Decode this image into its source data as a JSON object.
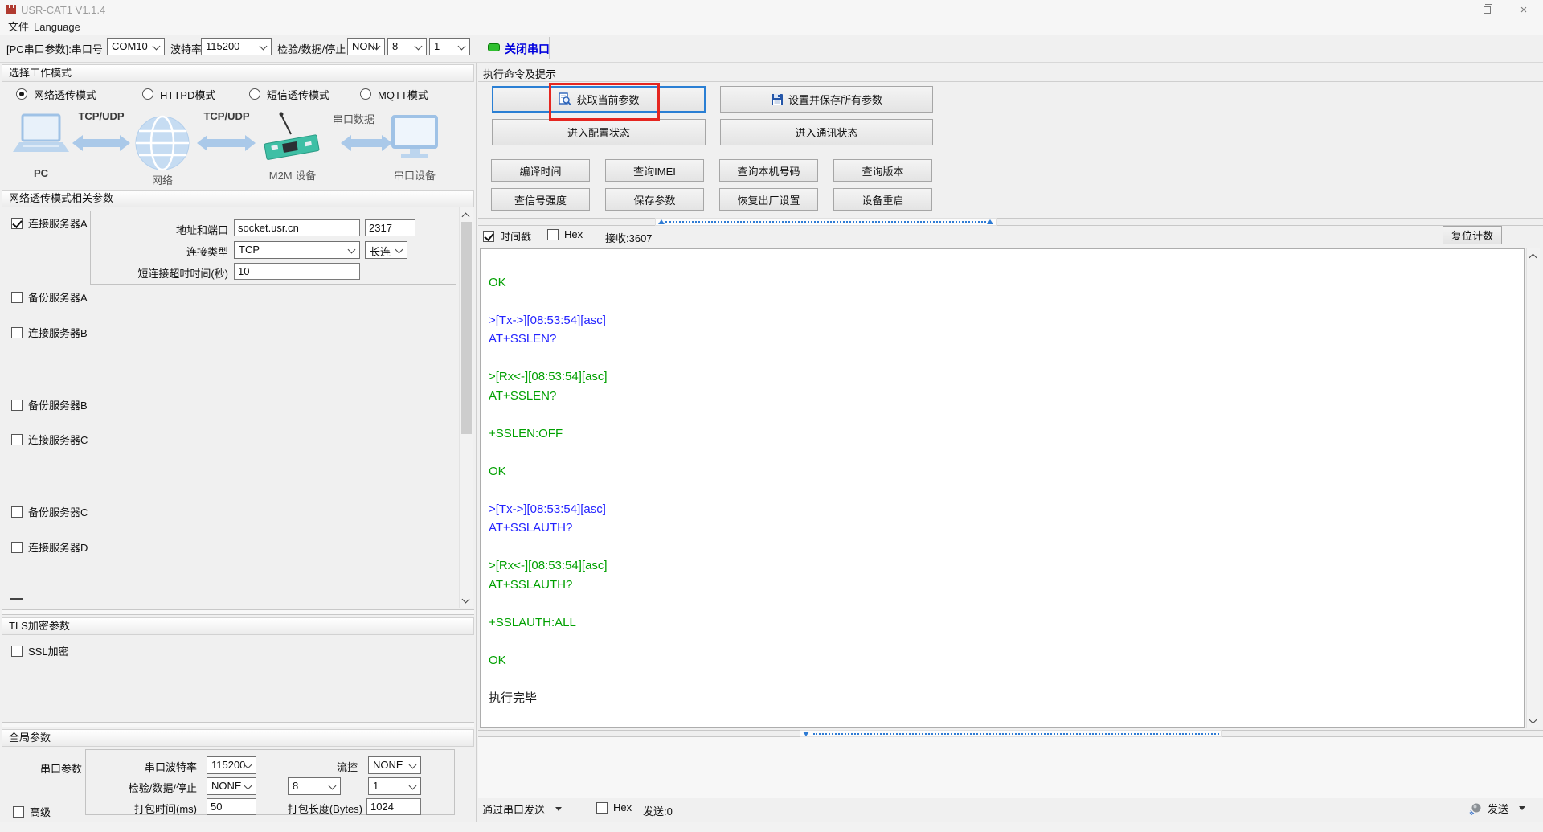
{
  "colors": {
    "led_green": "#2fbf2f",
    "close_serial_blue": "#0000dd",
    "focus_blue": "#2a7fd4",
    "annotation_red": "#e52620",
    "log_green": "#00a000",
    "log_blue": "#2323ff"
  },
  "window": {
    "title": "USR-CAT1 V1.1.4"
  },
  "menu": {
    "file": "文件",
    "language": "Language"
  },
  "toolbar": {
    "port_label": "[PC串口参数]:串口号",
    "port": "COM10",
    "baud_label": "波特率",
    "baud": "115200",
    "frame_label": "检验/数据/停止",
    "parity": "NONI",
    "data_bits": "8",
    "stop_bits": "1",
    "close_serial": "关闭串口"
  },
  "work_mode": {
    "header": "选择工作模式",
    "options": [
      {
        "label": "网络透传模式",
        "state": "selected"
      },
      {
        "label": "HTTPD模式",
        "state": ""
      },
      {
        "label": "短信透传模式",
        "state": ""
      },
      {
        "label": "MQTT模式",
        "state": ""
      }
    ]
  },
  "diagram": {
    "link1": "TCP/UDP",
    "link2": "TCP/UDP",
    "link3": "串口数据",
    "pc": "PC",
    "network": "网络",
    "m2m": "M2M 设备",
    "serial_device": "串口设备"
  },
  "net_params": {
    "header": "网络透传模式相关参数",
    "server_a_label": "连接服务器A",
    "addr_label": "地址和端口",
    "addr": "socket.usr.cn",
    "port": "2317",
    "type_label": "连接类型",
    "conn_type": "TCP",
    "keep_mode": "长连",
    "timeout_label": "短连接超时时间(秒)",
    "timeout": "10",
    "other_servers": [
      "备份服务器A",
      "连接服务器B",
      "备份服务器B",
      "连接服务器C",
      "备份服务器C",
      "连接服务器D"
    ]
  },
  "tls": {
    "header": "TLS加密参数",
    "ssl_label": "SSL加密"
  },
  "global_params": {
    "header": "全局参数",
    "serial_label": "串口参数",
    "baud_label": "串口波特率",
    "baud": "115200",
    "flow_label": "流控",
    "flow": "NONE",
    "frame_label": "检验/数据/停止",
    "parity": "NONE",
    "data_bits": "8",
    "stop_bits": "1",
    "pack_time_label": "打包时间(ms)",
    "pack_time": "50",
    "pack_len_label": "打包长度(Bytes)",
    "pack_len": "1024",
    "advanced_label": "高级"
  },
  "commands": {
    "header": "执行命令及提示",
    "get_params": "获取当前参数",
    "set_save": "设置并保存所有参数",
    "enter_config": "进入配置状态",
    "enter_comm": "进入通讯状态",
    "small_buttons": [
      "编译时间",
      "查询IMEI",
      "查询本机号码",
      "查询版本",
      "查信号强度",
      "保存参数",
      "恢复出厂设置",
      "设备重启"
    ]
  },
  "receive": {
    "timestamp_label": "时间戳",
    "hex_label": "Hex",
    "count": "接收:3607",
    "reset_label": "复位计数",
    "log": [
      {
        "text": "",
        "color": "dark"
      },
      {
        "text": "OK",
        "color": "green"
      },
      {
        "text": "",
        "color": "dark"
      },
      {
        "text": ">[Tx->][08:53:54][asc]",
        "color": "blue"
      },
      {
        "text": "AT+SSLEN?",
        "color": "blue"
      },
      {
        "text": "",
        "color": "dark"
      },
      {
        "text": ">[Rx<-][08:53:54][asc]",
        "color": "green"
      },
      {
        "text": "AT+SSLEN?",
        "color": "green"
      },
      {
        "text": "",
        "color": "dark"
      },
      {
        "text": "+SSLEN:OFF",
        "color": "green"
      },
      {
        "text": "",
        "color": "dark"
      },
      {
        "text": "OK",
        "color": "green"
      },
      {
        "text": "",
        "color": "dark"
      },
      {
        "text": ">[Tx->][08:53:54][asc]",
        "color": "blue"
      },
      {
        "text": "AT+SSLAUTH?",
        "color": "blue"
      },
      {
        "text": "",
        "color": "dark"
      },
      {
        "text": ">[Rx<-][08:53:54][asc]",
        "color": "green"
      },
      {
        "text": "AT+SSLAUTH?",
        "color": "green"
      },
      {
        "text": "",
        "color": "dark"
      },
      {
        "text": "+SSLAUTH:ALL",
        "color": "green"
      },
      {
        "text": "",
        "color": "dark"
      },
      {
        "text": "OK",
        "color": "green"
      },
      {
        "text": "",
        "color": "dark"
      },
      {
        "text": "执行完毕",
        "color": "dark"
      }
    ]
  },
  "send": {
    "via_label": "通过串口发送",
    "hex_label": "Hex",
    "count": "发送:0",
    "send_label": "发送"
  }
}
